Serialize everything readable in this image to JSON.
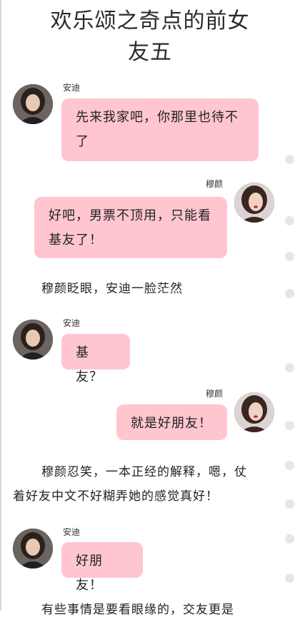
{
  "title_line1": "欢乐颂之奇点的前女",
  "title_line2": "友五",
  "messages": [
    {
      "name": "安迪",
      "text": "先来我家吧，你那里也待不了"
    },
    {
      "name": "穆颜",
      "text": "好吧，男票不顶用，只能看基友了！"
    },
    {
      "narration": "穆颜眨眼，安迪一脸茫然"
    },
    {
      "name": "安迪",
      "text": "基友？"
    },
    {
      "name": "穆颜",
      "text": "就是好朋友！"
    },
    {
      "narration_line1": "穆颜忍笑，一本正经的解释，嗯，仗",
      "narration_line2": "着好友中文不好糊弄她的感觉真好！"
    },
    {
      "name": "安迪",
      "text": "好朋友！"
    },
    {
      "narration_cut": "有些事情是要看眼缘的，交友更是"
    }
  ],
  "colors": {
    "bubble": "#ffc6d0",
    "scroll_dot": "#e6e6e6"
  },
  "icons": {
    "avatar_andi": "woman-avatar-icon",
    "avatar_muyan": "woman-avatar-icon"
  }
}
